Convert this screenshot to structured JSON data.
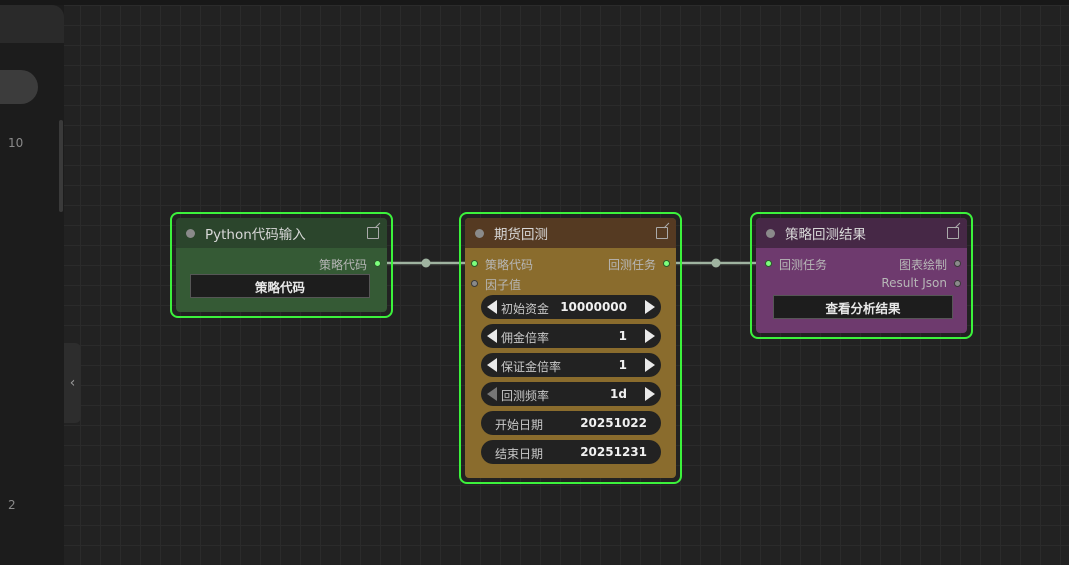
{
  "sidebar": {
    "numbers": [
      "10",
      "2"
    ],
    "collapse_icon": "chevron-left-icon",
    "collapse_glyph": "‹"
  },
  "nodes": {
    "python_input": {
      "title": "Python代码输入",
      "outputs": [
        "策略代码"
      ],
      "button_label": "策略代码",
      "color": "#355a35"
    },
    "futures_backtest": {
      "title": "期货回测",
      "inputs": [
        "策略代码",
        "因子值"
      ],
      "outputs": [
        "回测任务"
      ],
      "widgets": [
        {
          "label": "初始资金",
          "value": "10000000"
        },
        {
          "label": "佣金倍率",
          "value": "1"
        },
        {
          "label": "保证金倍率",
          "value": "1"
        },
        {
          "label": "回测频率",
          "value": "1d"
        },
        {
          "label": "开始日期",
          "value": "20251022"
        },
        {
          "label": "结束日期",
          "value": "20251231"
        }
      ],
      "color": "#8a6c2d"
    },
    "backtest_result": {
      "title": "策略回测结果",
      "inputs": [
        "回测任务"
      ],
      "outputs": [
        "图表绘制",
        "Result Json"
      ],
      "button_label": "查看分析结果",
      "color": "#6e3a6e"
    }
  },
  "colors": {
    "selection_border": "#3cf23c",
    "link": "#9fb3a0",
    "socket_connected": "#7dff7d"
  }
}
